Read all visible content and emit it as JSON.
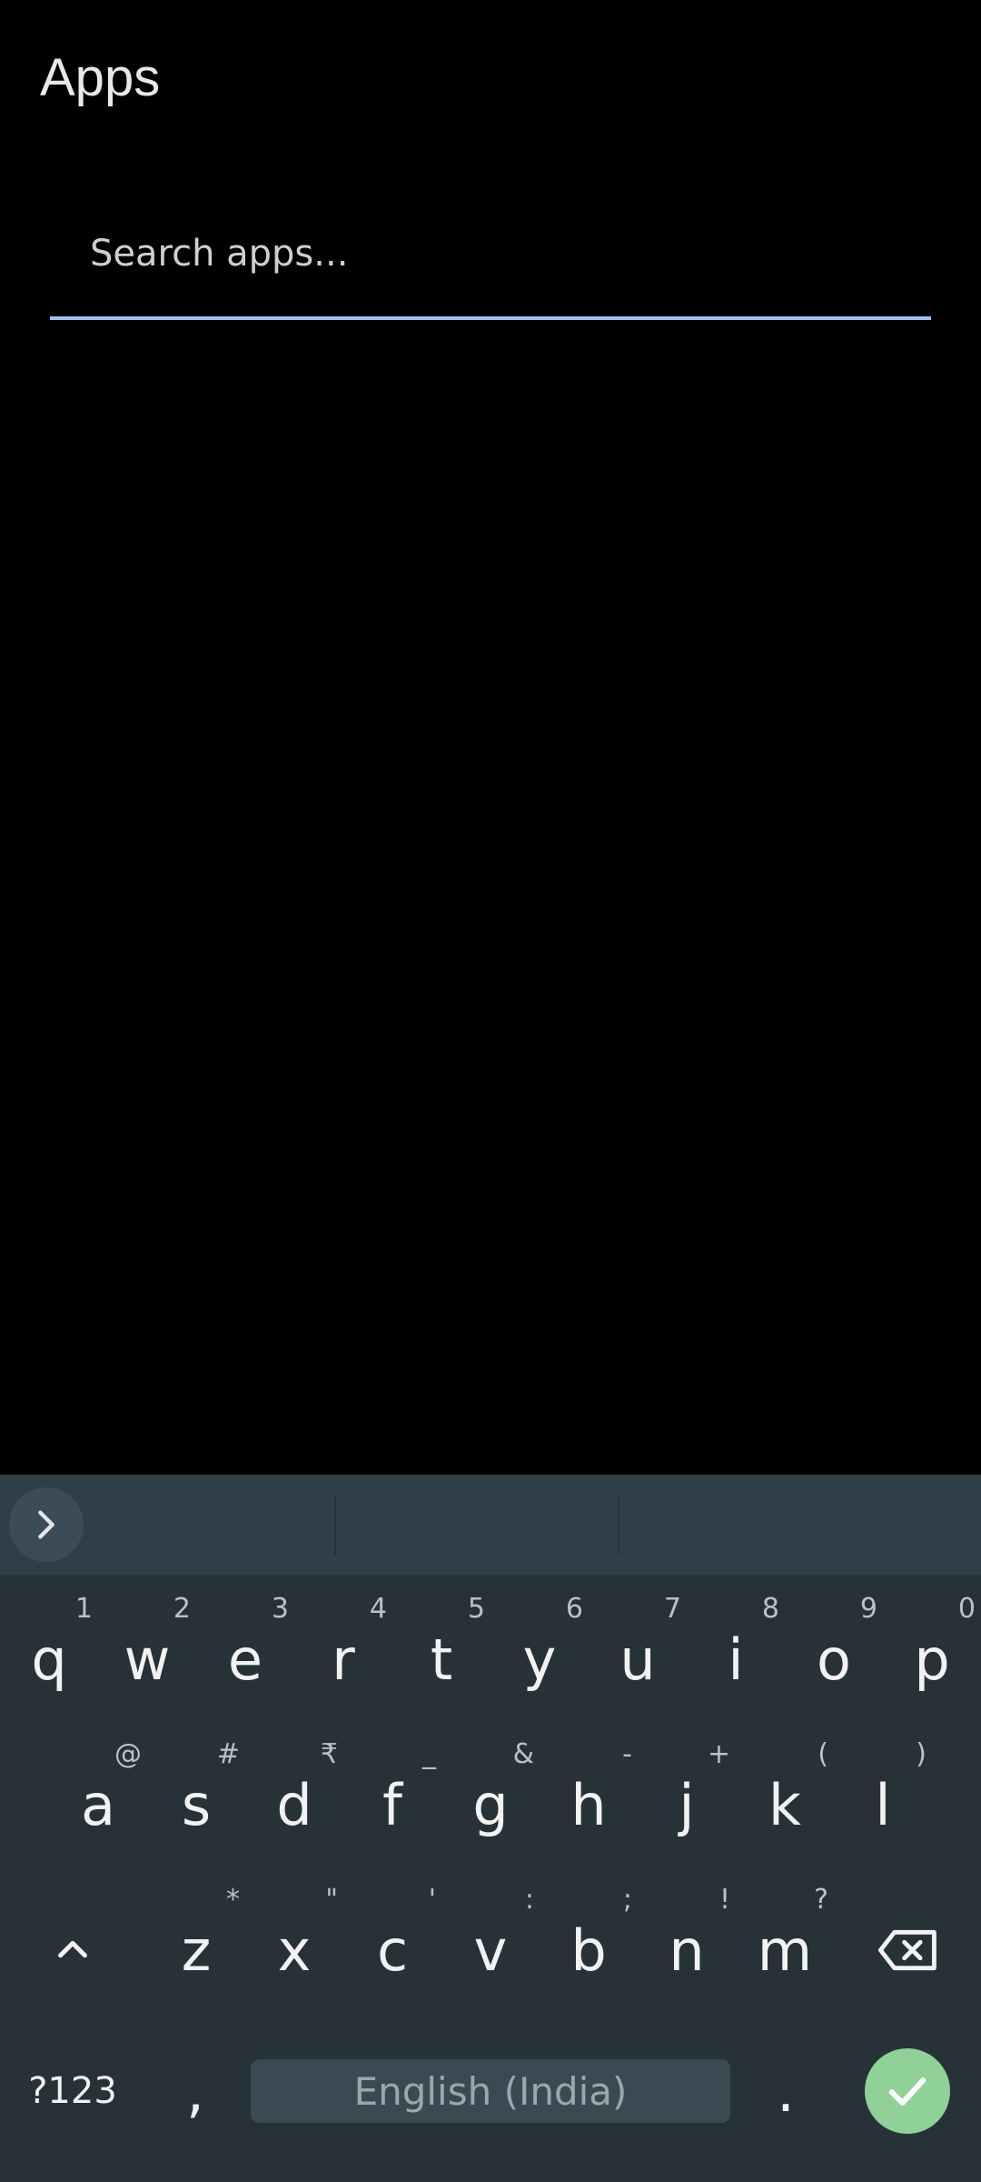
{
  "header": {
    "title": "Apps"
  },
  "search": {
    "placeholder": "Search apps..."
  },
  "keyboard": {
    "row1": [
      {
        "main": "q",
        "hint": "1"
      },
      {
        "main": "w",
        "hint": "2"
      },
      {
        "main": "e",
        "hint": "3"
      },
      {
        "main": "r",
        "hint": "4"
      },
      {
        "main": "t",
        "hint": "5"
      },
      {
        "main": "y",
        "hint": "6"
      },
      {
        "main": "u",
        "hint": "7"
      },
      {
        "main": "i",
        "hint": "8"
      },
      {
        "main": "o",
        "hint": "9"
      },
      {
        "main": "p",
        "hint": "0"
      }
    ],
    "row2": [
      {
        "main": "a",
        "hint": "@"
      },
      {
        "main": "s",
        "hint": "#"
      },
      {
        "main": "d",
        "hint": "₹"
      },
      {
        "main": "f",
        "hint": "_"
      },
      {
        "main": "g",
        "hint": "&"
      },
      {
        "main": "h",
        "hint": "-"
      },
      {
        "main": "j",
        "hint": "+"
      },
      {
        "main": "k",
        "hint": "("
      },
      {
        "main": "l",
        "hint": ")"
      }
    ],
    "row3": [
      {
        "main": "z",
        "hint": "*"
      },
      {
        "main": "x",
        "hint": "\""
      },
      {
        "main": "c",
        "hint": "'"
      },
      {
        "main": "v",
        "hint": ":"
      },
      {
        "main": "b",
        "hint": ";"
      },
      {
        "main": "n",
        "hint": "!"
      },
      {
        "main": "m",
        "hint": "?"
      }
    ],
    "symbols_label": "?123",
    "comma": ",",
    "period": ".",
    "space_label": "English (India)",
    "icons": {
      "expand": "chevron-right-icon",
      "shift": "shift-icon",
      "backspace": "backspace-icon",
      "enter": "check-icon"
    },
    "colors": {
      "background": "#263238",
      "suggestion_strip": "#2f3f48",
      "enter": "#8fd197",
      "accent": "#9fc4f0"
    }
  }
}
